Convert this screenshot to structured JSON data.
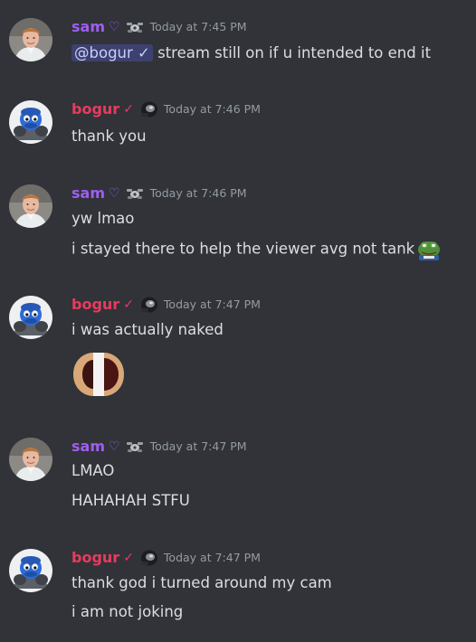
{
  "colors": {
    "background": "#313338",
    "sam_name": "#a05ef0",
    "bogur_name": "#e93b5f",
    "timestamp": "#949ba4",
    "text": "#dbdee1",
    "mention_bg": "#3c4270"
  },
  "messages": [
    {
      "author": "sam",
      "glyph": "♡",
      "role_icon": "drone-icon",
      "timestamp": "Today at 7:45 PM",
      "mention": "@bogur ✓",
      "lines": [
        "stream still on if u intended to end it"
      ]
    },
    {
      "author": "bogur",
      "glyph": "✓",
      "role_icon": "helmet-icon",
      "timestamp": "Today at 7:46 PM",
      "lines": [
        "thank you"
      ]
    },
    {
      "author": "sam",
      "glyph": "♡",
      "role_icon": "drone-icon",
      "timestamp": "Today at 7:46 PM",
      "lines": [
        "yw lmao",
        "i stayed there to help the viewer avg not tank"
      ],
      "emoji": "frog-emoji"
    },
    {
      "author": "bogur",
      "glyph": "✓",
      "role_icon": "helmet-icon",
      "timestamp": "Today at 7:47 PM",
      "lines": [
        "i was actually naked"
      ],
      "attachment": "sticker-image"
    },
    {
      "author": "sam",
      "glyph": "♡",
      "role_icon": "drone-icon",
      "timestamp": "Today at 7:47 PM",
      "lines": [
        "LMAO",
        "HAHAHAH STFU"
      ]
    },
    {
      "author": "bogur",
      "glyph": "✓",
      "role_icon": "helmet-icon",
      "timestamp": "Today at 7:47 PM",
      "lines": [
        "thank god i turned around my cam",
        "i am not joking"
      ]
    }
  ]
}
